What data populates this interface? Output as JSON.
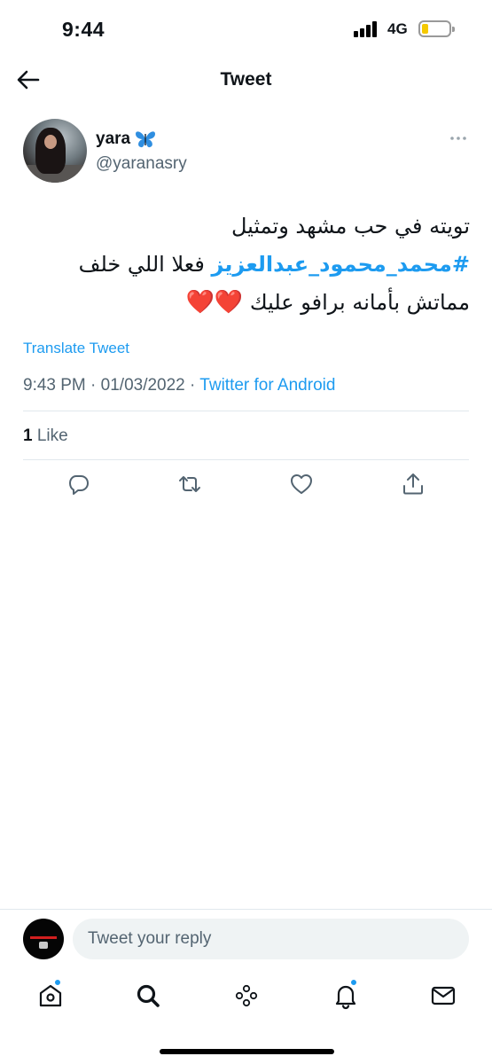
{
  "status_bar": {
    "time": "9:44",
    "network": "4G",
    "battery_level": 0.22,
    "battery_color": "#f5c900"
  },
  "header": {
    "title": "Tweet",
    "back_icon": "arrow-left-icon"
  },
  "tweet": {
    "author": {
      "name": "yara",
      "name_emoji": "butterfly-icon",
      "handle": "@yaranasry"
    },
    "more_icon": "more-horizontal-icon",
    "text_line_1": "تويته في حب مشهد وتمثيل",
    "hashtag": "#محمد_محمود_عبدالعزيز",
    "text_line_2_rest": "فعلا اللي خلف",
    "text_line_3": "مماتش بأمانه برافو عليك",
    "hearts": "❤️❤️",
    "translate_label": "Translate Tweet",
    "time": "9:43 PM",
    "date": "01/03/2022",
    "separator": "·",
    "source": "Twitter for Android",
    "like_count": "1",
    "like_label": "Like"
  },
  "actions": [
    {
      "icon": "reply-icon"
    },
    {
      "icon": "retweet-icon"
    },
    {
      "icon": "heart-icon"
    },
    {
      "icon": "share-icon"
    }
  ],
  "reply": {
    "placeholder": "Tweet your reply"
  },
  "bottom_nav": [
    {
      "icon": "home-icon",
      "has_dot": true
    },
    {
      "icon": "search-icon",
      "has_dot": false
    },
    {
      "icon": "spaces-icon",
      "has_dot": false
    },
    {
      "icon": "notifications-icon",
      "has_dot": true
    },
    {
      "icon": "messages-icon",
      "has_dot": false
    }
  ],
  "colors": {
    "accent": "#1d9bf0",
    "text": "#0f1419",
    "secondary": "#536471",
    "divider": "#e1e8ed",
    "heart": "#e0245e"
  }
}
